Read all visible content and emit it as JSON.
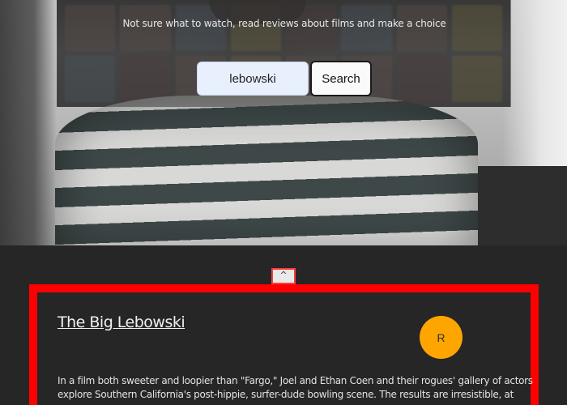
{
  "hero": {
    "tagline": "Not sure what to watch, read reviews about films and make a choice"
  },
  "search": {
    "value": "lebowski",
    "button_label": "Search"
  },
  "scroll_top": {
    "label": "^"
  },
  "review": {
    "title": "The Big Lebowski",
    "avatar_initial": "R",
    "text": "In a film both sweeter and loopier than \"Fargo,\" Joel and Ethan Coen and their rogues' gallery of actors explore Southern California's post-hippie, surfer-dude bowling scene. The results are irresistible, at"
  },
  "colors": {
    "accent_border": "#ff0000",
    "avatar_bg": "#ffa500",
    "page_bg": "#262626",
    "input_bg": "#e8f0fe"
  }
}
